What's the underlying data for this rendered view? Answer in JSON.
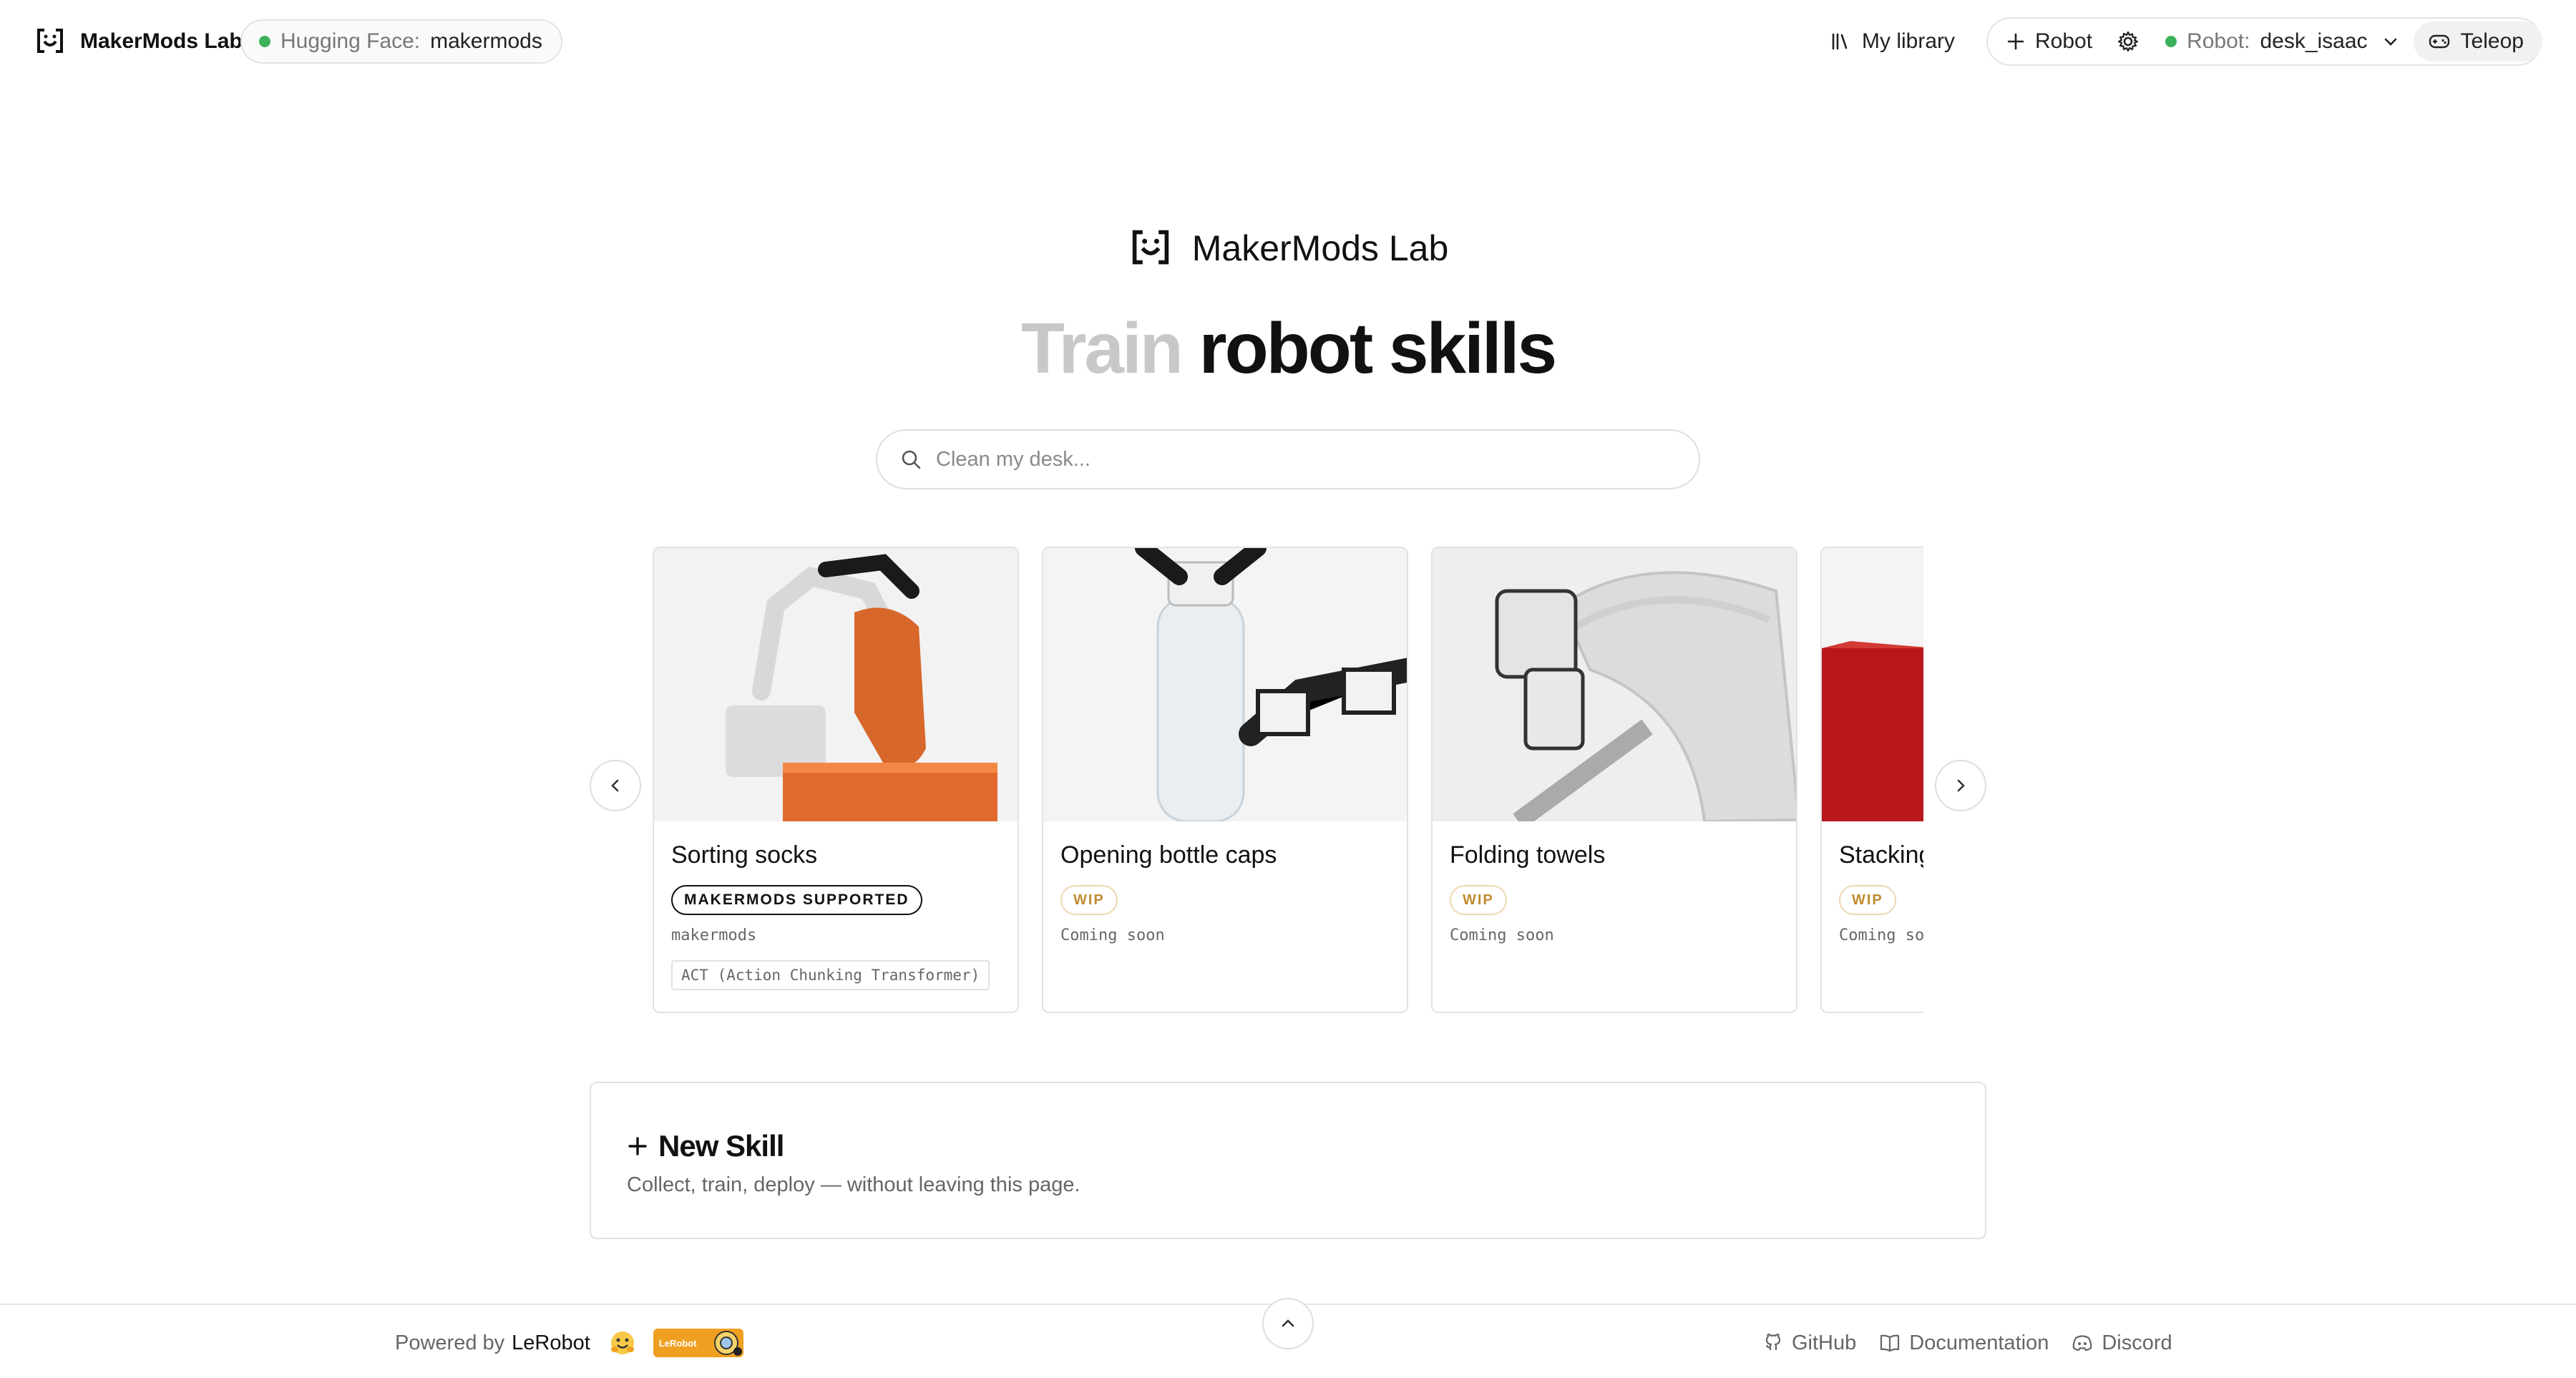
{
  "header": {
    "brand": "MakerMods Lab",
    "hf_status": {
      "label": "Hugging Face:",
      "user": "makermods",
      "status_color": "#3cb15a"
    },
    "library_label": "My library",
    "robot_add_label": "Robot",
    "robot_select": {
      "label": "Robot:",
      "value": "desk_isaac",
      "status_color": "#3cb15a"
    },
    "teleop_label": "Teleop"
  },
  "hero": {
    "brand": "MakerMods Lab",
    "headline_muted": "Train",
    "headline_main": "robot skills",
    "search_placeholder": "Clean my desk..."
  },
  "carousel": {
    "cards": [
      {
        "title": "Sorting socks",
        "badge": "MAKERMODS SUPPORTED",
        "badge_type": "supported",
        "subtitle": "makermods",
        "tag": "ACT (Action Chunking Transformer)",
        "image": "robot-arm-holding-orange-sock-icon"
      },
      {
        "title": "Opening bottle caps",
        "badge": "WIP",
        "badge_type": "wip",
        "subtitle": "Coming soon",
        "image": "robot-gripper-water-bottle-icon"
      },
      {
        "title": "Folding towels",
        "badge": "WIP",
        "badge_type": "wip",
        "subtitle": "Coming soon",
        "image": "robot-arm-folding-towel-icon"
      },
      {
        "title": "Stacking",
        "badge": "WIP",
        "badge_type": "wip",
        "subtitle": "Coming soon",
        "image": "red-blocks-icon"
      }
    ]
  },
  "new_skill": {
    "title": "New Skill",
    "subtitle": "Collect, train, deploy — without leaving this page."
  },
  "footer": {
    "powered_by": "Powered by",
    "powered_name": "LeRobot",
    "badge_text": "LeRobot",
    "links": [
      "GitHub",
      "Documentation",
      "Discord"
    ]
  },
  "colors": {
    "accent_green": "#3cb15a",
    "wip": "#c08b2f",
    "muted_headline": "#c8c8c8"
  }
}
